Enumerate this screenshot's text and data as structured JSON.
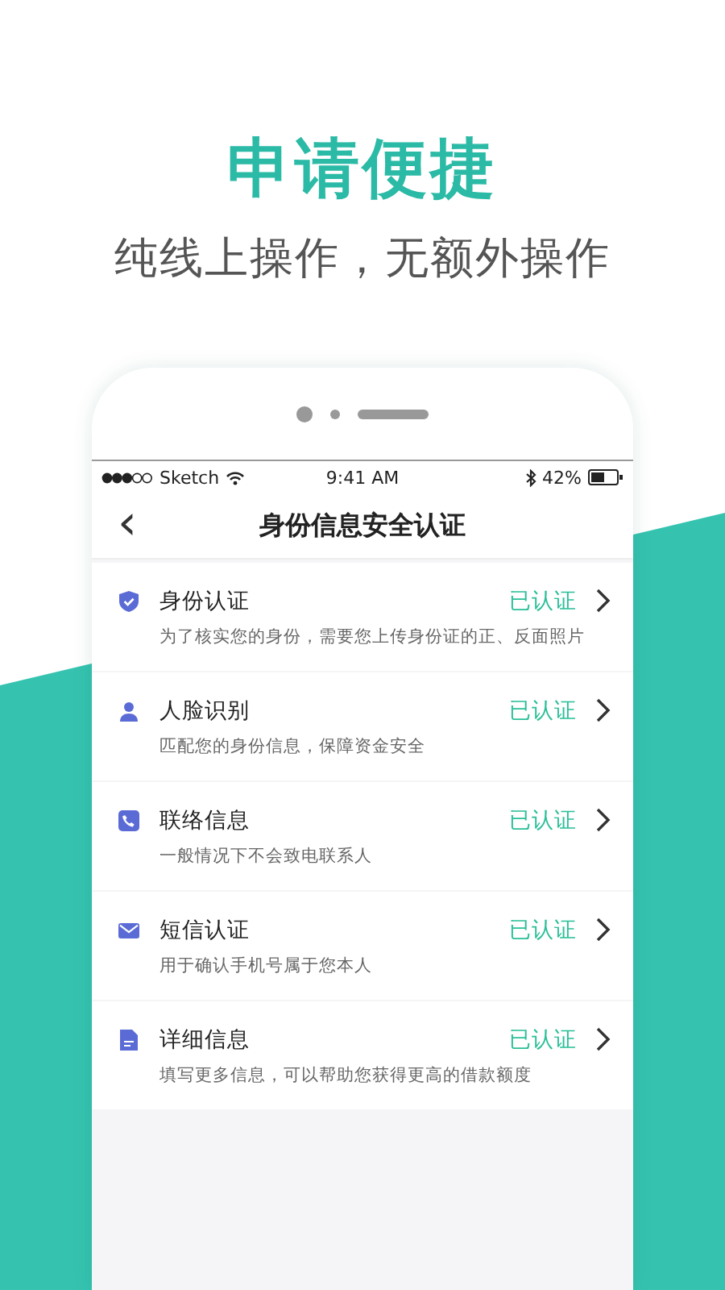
{
  "headline": "申请便捷",
  "subheadline": "纯线上操作，无额外操作",
  "status_bar": {
    "carrier": "Sketch",
    "time": "9:41 AM",
    "battery": "42%"
  },
  "nav": {
    "back": "‹",
    "title": "身份信息安全认证"
  },
  "items": [
    {
      "kind": "shield",
      "title": "身份认证",
      "status": "已认证",
      "description": "为了核实您的身份，需要您上传身份证的正、反面照片"
    },
    {
      "kind": "person",
      "title": "人脸识别",
      "status": "已认证",
      "description": "匹配您的身份信息，保障资金安全"
    },
    {
      "kind": "phone",
      "title": "联络信息",
      "status": "已认证",
      "description": "一般情况下不会致电联系人"
    },
    {
      "kind": "mail",
      "title": "短信认证",
      "status": "已认证",
      "description": "用于确认手机号属于您本人"
    },
    {
      "kind": "doc",
      "title": "详细信息",
      "status": "已认证",
      "description": "填写更多信息，可以帮助您获得更高的借款额度"
    }
  ]
}
